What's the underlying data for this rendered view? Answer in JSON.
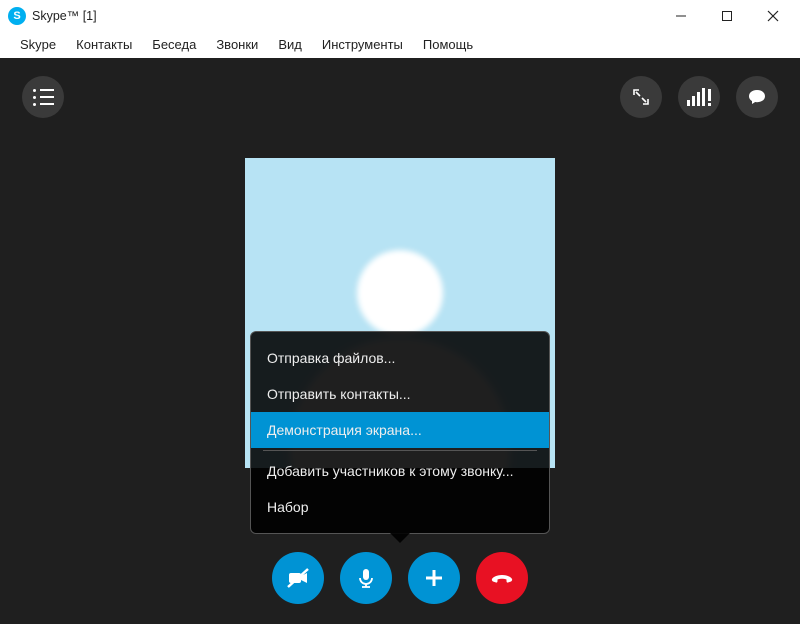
{
  "window": {
    "title": "Skype™ [1]"
  },
  "menu": {
    "items": [
      "Skype",
      "Контакты",
      "Беседа",
      "Звонки",
      "Вид",
      "Инструменты",
      "Помощь"
    ]
  },
  "popup": {
    "items": [
      {
        "label": "Отправка файлов...",
        "selected": false
      },
      {
        "label": "Отправить контакты...",
        "selected": false
      },
      {
        "label": "Демонстрация экрана...",
        "selected": true
      },
      {
        "label": "Добавить участников к этому звонку...",
        "selected": false,
        "separator_before": true
      },
      {
        "label": "Набор",
        "selected": false
      }
    ]
  },
  "controls": {
    "camera": "camera-off",
    "mic": "microphone",
    "add": "plus",
    "hangup": "hang-up"
  },
  "colors": {
    "accent": "#0093d4",
    "hangup": "#e81123",
    "call_bg": "#1f1f1f",
    "avatar_bg": "#b7e3f4"
  }
}
